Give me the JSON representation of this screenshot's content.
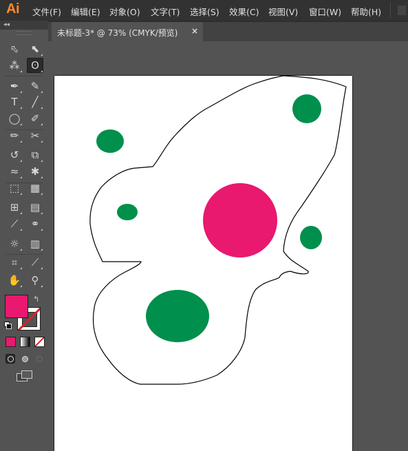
{
  "app": {
    "logo": "Ai",
    "menu": [
      "文件(F)",
      "编辑(E)",
      "对象(O)",
      "文字(T)",
      "选择(S)",
      "效果(C)",
      "视图(V)",
      "窗口(W)",
      "帮助(H)"
    ]
  },
  "toolbox": {
    "collapse": "◂◂",
    "tools": [
      {
        "name": "selection-tool",
        "glyph": "⬁"
      },
      {
        "name": "direct-selection-tool",
        "glyph": "⬉"
      },
      {
        "name": "magic-wand-tool",
        "glyph": "⁂"
      },
      {
        "name": "lasso-tool",
        "glyph": "ʘ"
      },
      {
        "name": "pen-tool",
        "glyph": "✒"
      },
      {
        "name": "curvature-tool",
        "glyph": "✎"
      },
      {
        "name": "type-tool",
        "glyph": "T"
      },
      {
        "name": "line-segment-tool",
        "glyph": "╱"
      },
      {
        "name": "ellipse-tool",
        "glyph": "◯"
      },
      {
        "name": "paintbrush-tool",
        "glyph": "✐"
      },
      {
        "name": "shaper-tool",
        "glyph": "✏"
      },
      {
        "name": "scissors-tool",
        "glyph": "✂"
      },
      {
        "name": "rotate-tool",
        "glyph": "↺"
      },
      {
        "name": "scale-tool",
        "glyph": "⧉"
      },
      {
        "name": "width-tool",
        "glyph": "≈"
      },
      {
        "name": "puppet-warp-tool",
        "glyph": "✱"
      },
      {
        "name": "free-transform-tool",
        "glyph": "⬚"
      },
      {
        "name": "perspective-grid-tool",
        "glyph": "▦"
      },
      {
        "name": "mesh-tool",
        "glyph": "⊞"
      },
      {
        "name": "gradient-tool",
        "glyph": "▤"
      },
      {
        "name": "eyedropper-tool",
        "glyph": "⟋"
      },
      {
        "name": "blend-tool",
        "glyph": "⚭"
      },
      {
        "name": "symbol-sprayer-tool",
        "glyph": "☼"
      },
      {
        "name": "column-graph-tool",
        "glyph": "▥"
      },
      {
        "name": "artboard-tool",
        "glyph": "⌗"
      },
      {
        "name": "slice-tool",
        "glyph": "⟋"
      },
      {
        "name": "hand-tool",
        "glyph": "✋"
      },
      {
        "name": "zoom-tool",
        "glyph": "⚲"
      }
    ],
    "swap_glyph": "↰"
  },
  "document": {
    "tab_title": "未标题-3* @ 73% (CMYK/预览)",
    "tab_close": "×"
  },
  "colors": {
    "fill": "#e8196e",
    "pink_circle": "#e8196e",
    "green_circle": "#008f4c",
    "outline": "#000000"
  }
}
